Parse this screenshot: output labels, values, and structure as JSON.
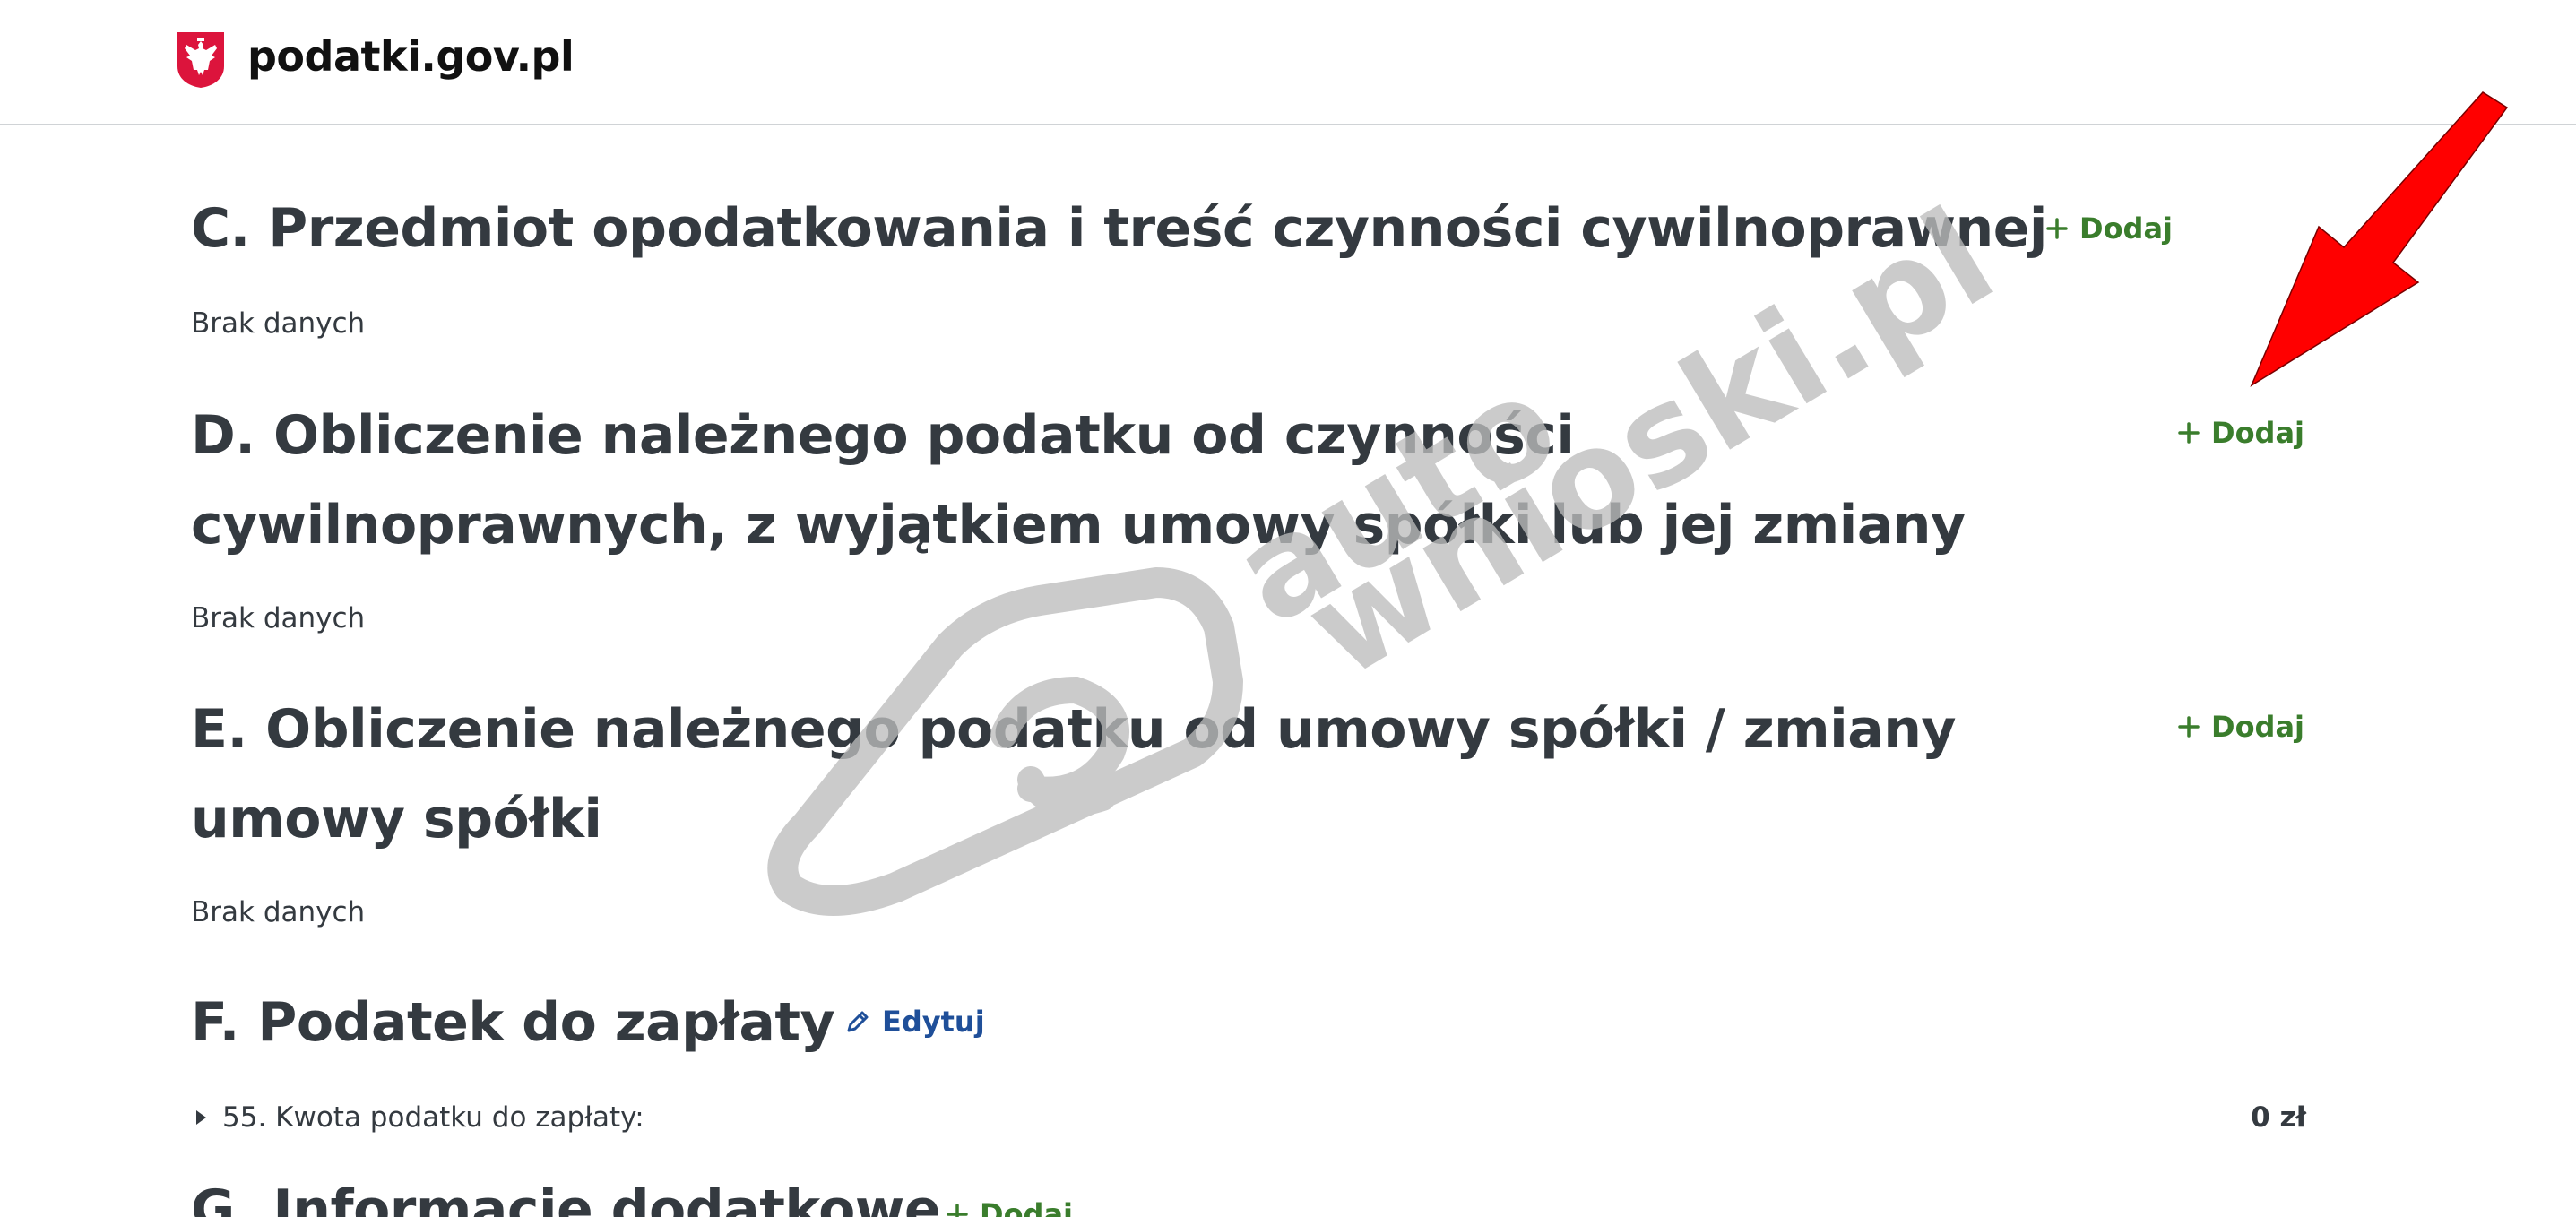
{
  "header": {
    "brand": "podatki.gov.pl",
    "emblem_icon": "polish-eagle-emblem-icon"
  },
  "sections": [
    {
      "heading": "C. Przedmiot opodatkowania i treść czynności cywilnoprawnej",
      "action_label": "Dodaj",
      "status": "Brak danych"
    },
    {
      "heading": "D. Obliczenie należnego podatku od czynności cywilnoprawnych, z wyjątkiem umowy spółki lub jej zmiany",
      "action_label": "Dodaj",
      "status": "Brak danych"
    },
    {
      "heading": "E. Obliczenie należnego podatku od umowy spółki / zmiany umowy spółki",
      "action_label": "Dodaj",
      "status": "Brak danych"
    },
    {
      "heading": "F. Podatek do zapłaty",
      "action_label": "Edytuj",
      "rows": [
        {
          "label": "55. Kwota podatku do zapłaty:",
          "value": "0 zł"
        }
      ]
    },
    {
      "heading": "G. Informacje dodatkowe",
      "action_label": "Dodaj"
    }
  ],
  "watermark": {
    "line1": "auto",
    "line2": "wnioski.pl"
  },
  "colors": {
    "heading": "#343a40",
    "add_action": "#3a7d2c",
    "edit_action": "#1f4f99",
    "divider": "#d0d3d6",
    "annotation_arrow": "#ff0000",
    "watermark": "#bdbdbd",
    "emblem_red": "#dc143c"
  }
}
